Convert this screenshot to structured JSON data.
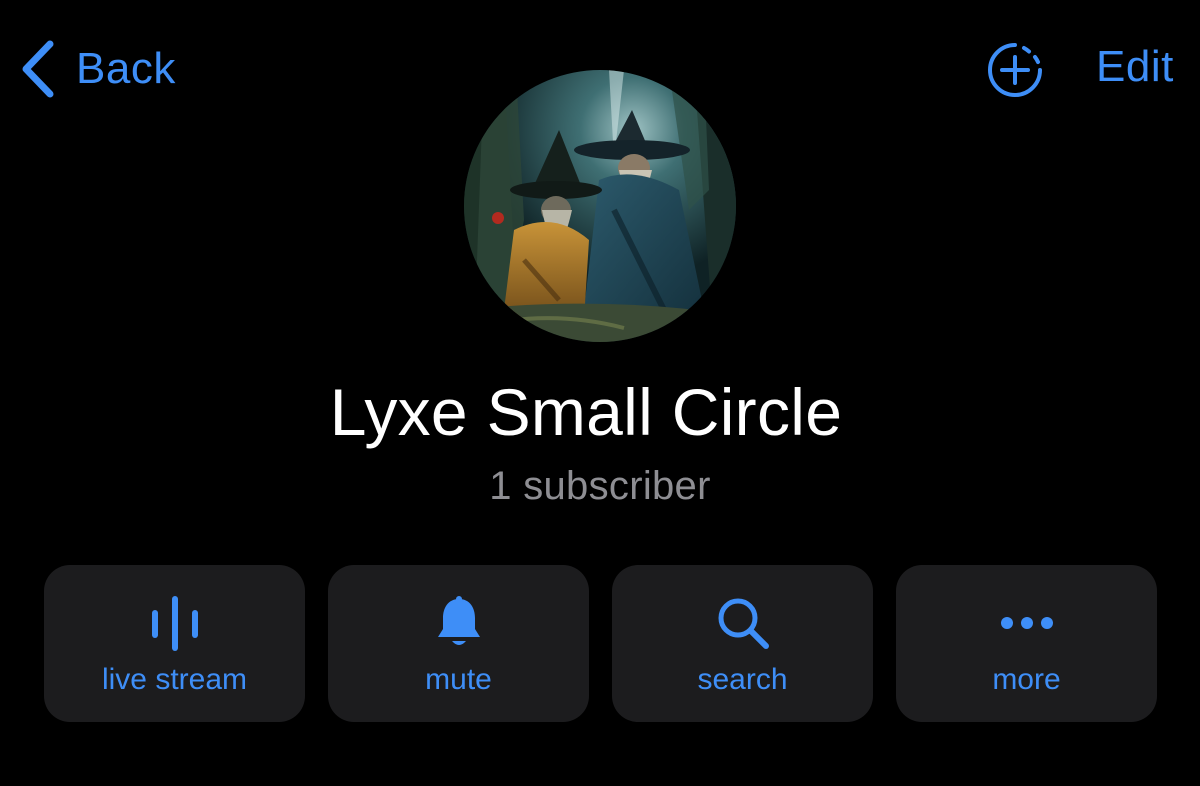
{
  "nav": {
    "back_label": "Back",
    "edit_label": "Edit",
    "add_icon": "add-circle-dashed-icon"
  },
  "channel": {
    "name": "Lyxe Small Circle",
    "subscribers": "1 subscriber",
    "avatar": "two-wizards-painting"
  },
  "actions": [
    {
      "label": "live stream",
      "icon": "live-stream-waveform-icon"
    },
    {
      "label": "mute",
      "icon": "bell-icon"
    },
    {
      "label": "search",
      "icon": "search-icon"
    },
    {
      "label": "more",
      "icon": "ellipsis-icon"
    }
  ],
  "colors": {
    "background": "#000000",
    "accent": "#3e8ef7",
    "card": "#1c1c1e",
    "secondary_text": "#8e8e93",
    "primary_text": "#ffffff"
  }
}
